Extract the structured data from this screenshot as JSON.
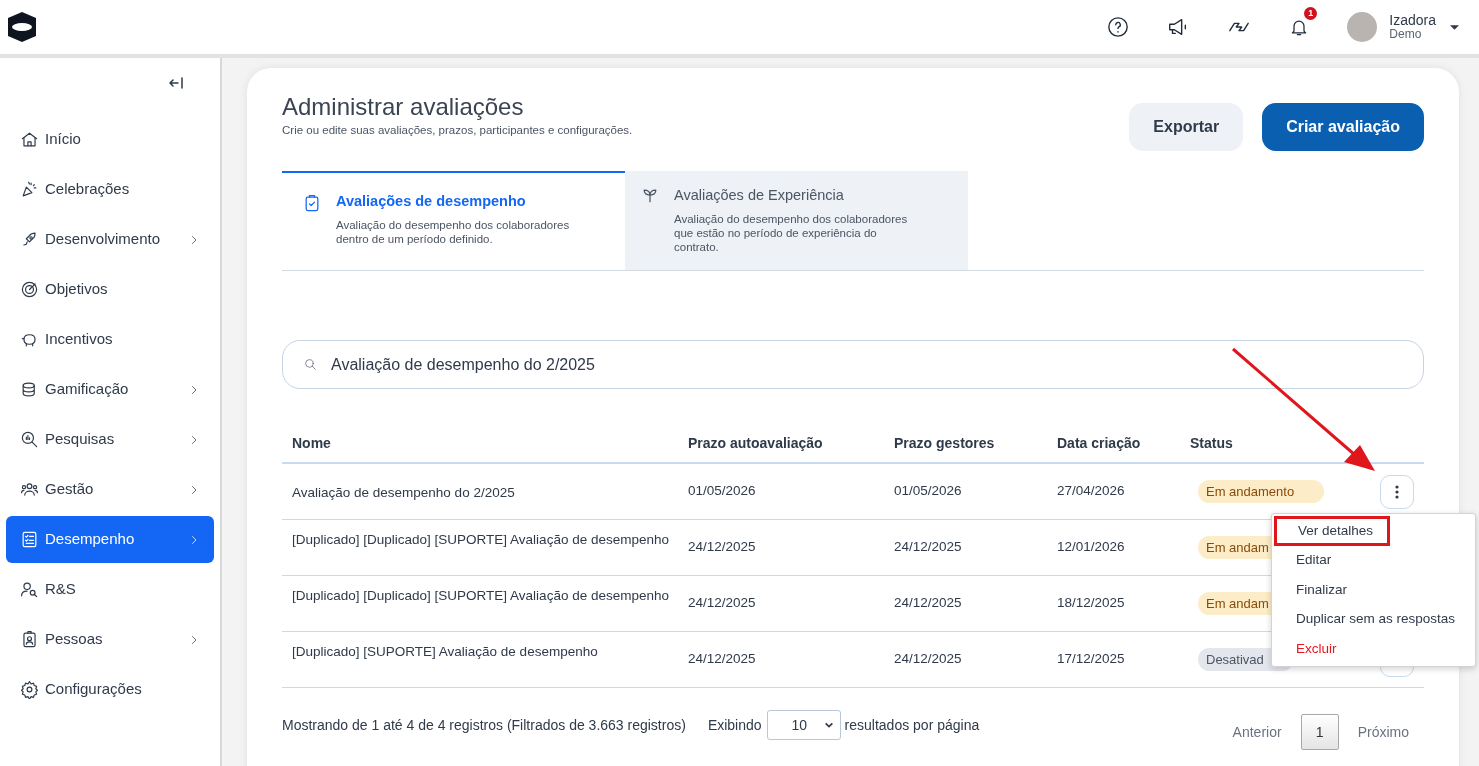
{
  "header": {
    "user": {
      "name": "Izadora",
      "subtitle": "Demo"
    },
    "notifications_badge": "1"
  },
  "sidebar": {
    "items": [
      {
        "label": "Início",
        "has_children": false,
        "selected": false
      },
      {
        "label": "Celebrações",
        "has_children": false,
        "selected": false
      },
      {
        "label": "Desenvolvimento",
        "has_children": true,
        "selected": false
      },
      {
        "label": "Objetivos",
        "has_children": false,
        "selected": false
      },
      {
        "label": "Incentivos",
        "has_children": false,
        "selected": false
      },
      {
        "label": "Gamificação",
        "has_children": true,
        "selected": false
      },
      {
        "label": "Pesquisas",
        "has_children": true,
        "selected": false
      },
      {
        "label": "Gestão",
        "has_children": true,
        "selected": false
      },
      {
        "label": "Desempenho",
        "has_children": true,
        "selected": true
      },
      {
        "label": "R&S",
        "has_children": false,
        "selected": false
      },
      {
        "label": "Pessoas",
        "has_children": true,
        "selected": false
      },
      {
        "label": "Configurações",
        "has_children": false,
        "selected": false
      }
    ]
  },
  "page": {
    "title": "Administrar avaliações",
    "subtitle": "Crie ou edite suas avaliações, prazos, participantes e configurações.",
    "buttons": [
      {
        "label": "Exportar",
        "kind": "secondary"
      },
      {
        "label": "Criar avaliação",
        "kind": "primary"
      }
    ]
  },
  "tabs": [
    {
      "title": "Avaliações de desempenho",
      "description": "Avaliação do desempenho dos colaboradores dentro de um período definido.",
      "selected": true
    },
    {
      "title": "Avaliações de Experiência",
      "description": "Avaliação do desempenho dos colaboradores que estão no período de experiência do contrato.",
      "selected": false
    }
  ],
  "search": {
    "value": "Avaliação de desempenho do 2/2025"
  },
  "table": {
    "columns": [
      "Nome",
      "Prazo autoavaliação",
      "Prazo gestores",
      "Data criação",
      "Status"
    ],
    "rows": [
      {
        "name": "Avaliação de desempenho do 2/2025",
        "self_deadline": "01/05/2026",
        "manager_deadline": "01/05/2026",
        "created": "27/04/2026",
        "status": {
          "label": "Em andamento",
          "kind": "in_progress"
        }
      },
      {
        "name": "[Duplicado] [Duplicado] [SUPORTE] Avaliação de desempenho",
        "self_deadline": "24/12/2025",
        "manager_deadline": "24/12/2025",
        "created": "12/01/2026",
        "status": {
          "label": "Em andam",
          "kind": "in_progress"
        }
      },
      {
        "name": "[Duplicado] [Duplicado] [SUPORTE] Avaliação de desempenho",
        "self_deadline": "24/12/2025",
        "manager_deadline": "24/12/2025",
        "created": "18/12/2025",
        "status": {
          "label": "Em andam",
          "kind": "in_progress"
        }
      },
      {
        "name": "[Duplicado] [SUPORTE] Avaliação de desempenho",
        "self_deadline": "24/12/2025",
        "manager_deadline": "24/12/2025",
        "created": "17/12/2025",
        "status": {
          "label": "Desativad",
          "kind": "disabled"
        }
      }
    ]
  },
  "row_menu": {
    "items": [
      {
        "label": "Ver detalhes",
        "kind": "normal",
        "highlighted": true
      },
      {
        "label": "Editar",
        "kind": "normal",
        "highlighted": false
      },
      {
        "label": "Finalizar",
        "kind": "normal",
        "highlighted": false
      },
      {
        "label": "Duplicar sem as respostas",
        "kind": "normal",
        "highlighted": false
      },
      {
        "label": "Excluir",
        "kind": "danger",
        "highlighted": false
      }
    ]
  },
  "footer": {
    "summary": "Mostrando de 1 até 4 de 4 registros (Filtrados de 3.663 registros)",
    "page_size_label": "Exibindo",
    "page_size": "10",
    "page_size_suffix": "resultados por página",
    "pagination": [
      {
        "label": "Anterior",
        "kind": "prev",
        "selected": false
      },
      {
        "label": "1",
        "kind": "page",
        "selected": true
      },
      {
        "label": "Próximo",
        "kind": "next",
        "selected": false
      }
    ]
  }
}
